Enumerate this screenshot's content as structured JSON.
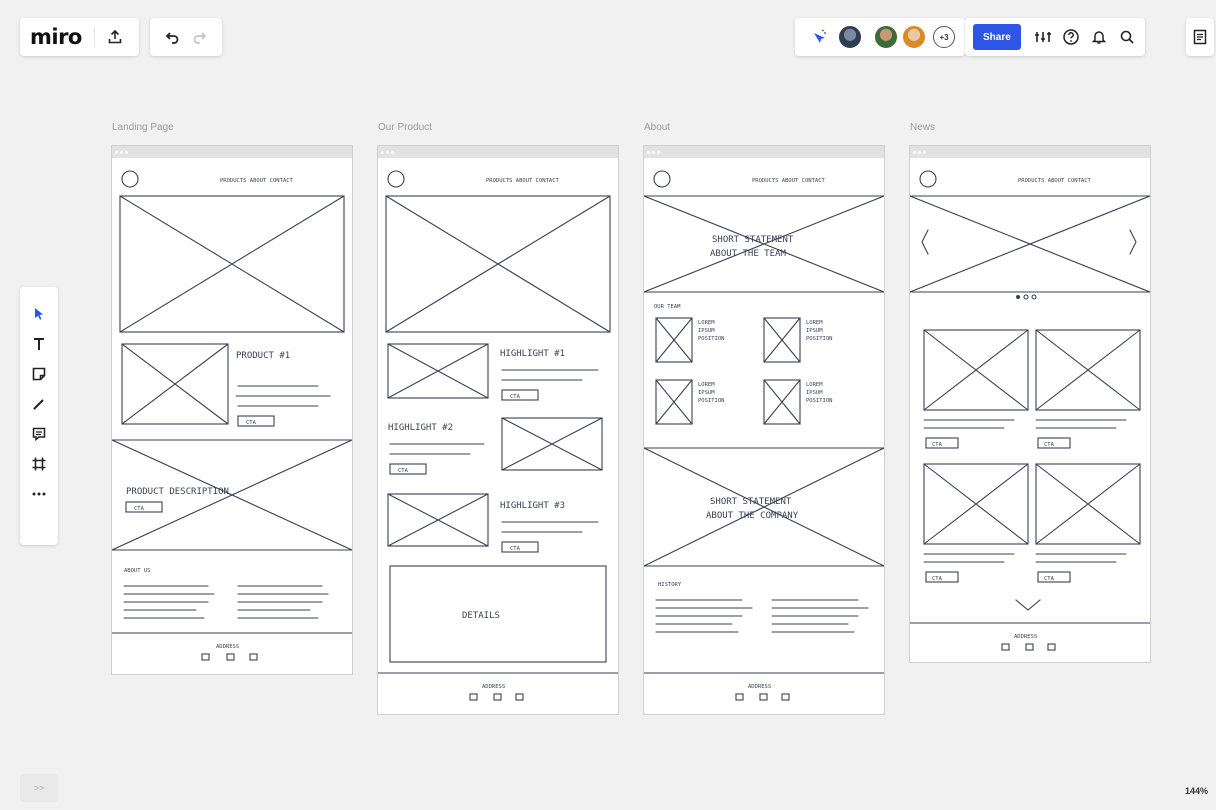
{
  "app": {
    "logo": "miro"
  },
  "topbar": {
    "collaborators_extra": "+3",
    "share_label": "Share"
  },
  "frames": [
    {
      "title": "Landing Page",
      "nav": "PRODUCTS  ABOUT  CONTACT",
      "texts": {
        "product": "PRODUCT #1",
        "cta": "CTA",
        "description": "PRODUCT DESCRIPTION",
        "about": "ABOUT US",
        "address": "ADDRESS"
      }
    },
    {
      "title": "Our Product",
      "nav": "PRODUCTS  ABOUT  CONTACT",
      "texts": {
        "h1": "HIGHLIGHT #1",
        "h2": "HIGHLIGHT #2",
        "h3": "HIGHLIGHT #3",
        "cta": "CTA",
        "details": "DETAILS",
        "address": "ADDRESS"
      }
    },
    {
      "title": "About",
      "nav": "PRODUCTS  ABOUT  CONTACT",
      "texts": {
        "team1": "SHORT STATEMENT",
        "team2": "ABOUT THE TEAM",
        "ourteam": "OUR TEAM",
        "member1": "LOREM",
        "member2": "IPSUM",
        "member3": "POSITION",
        "company1": "SHORT STATEMENT",
        "company2": "ABOUT THE COMPANY",
        "history": "HISTORY",
        "address": "ADDRESS"
      }
    },
    {
      "title": "News",
      "nav": "PRODUCTS  ABOUT  CONTACT",
      "texts": {
        "cta": "CTA",
        "address": "ADDRESS"
      }
    }
  ],
  "zoom": {
    "level": "144%"
  },
  "icons": {
    "upload": "upload-icon",
    "undo": "undo-icon",
    "redo": "redo-icon",
    "cursor": "cursor-icon",
    "settings": "settings-icon",
    "help": "help-icon",
    "bell": "bell-icon",
    "search": "search-icon",
    "board": "board-menu-icon"
  },
  "colors": {
    "accent": "#2d55e6",
    "canvas": "#f1f1f1",
    "sketch": "#3b3f55"
  }
}
